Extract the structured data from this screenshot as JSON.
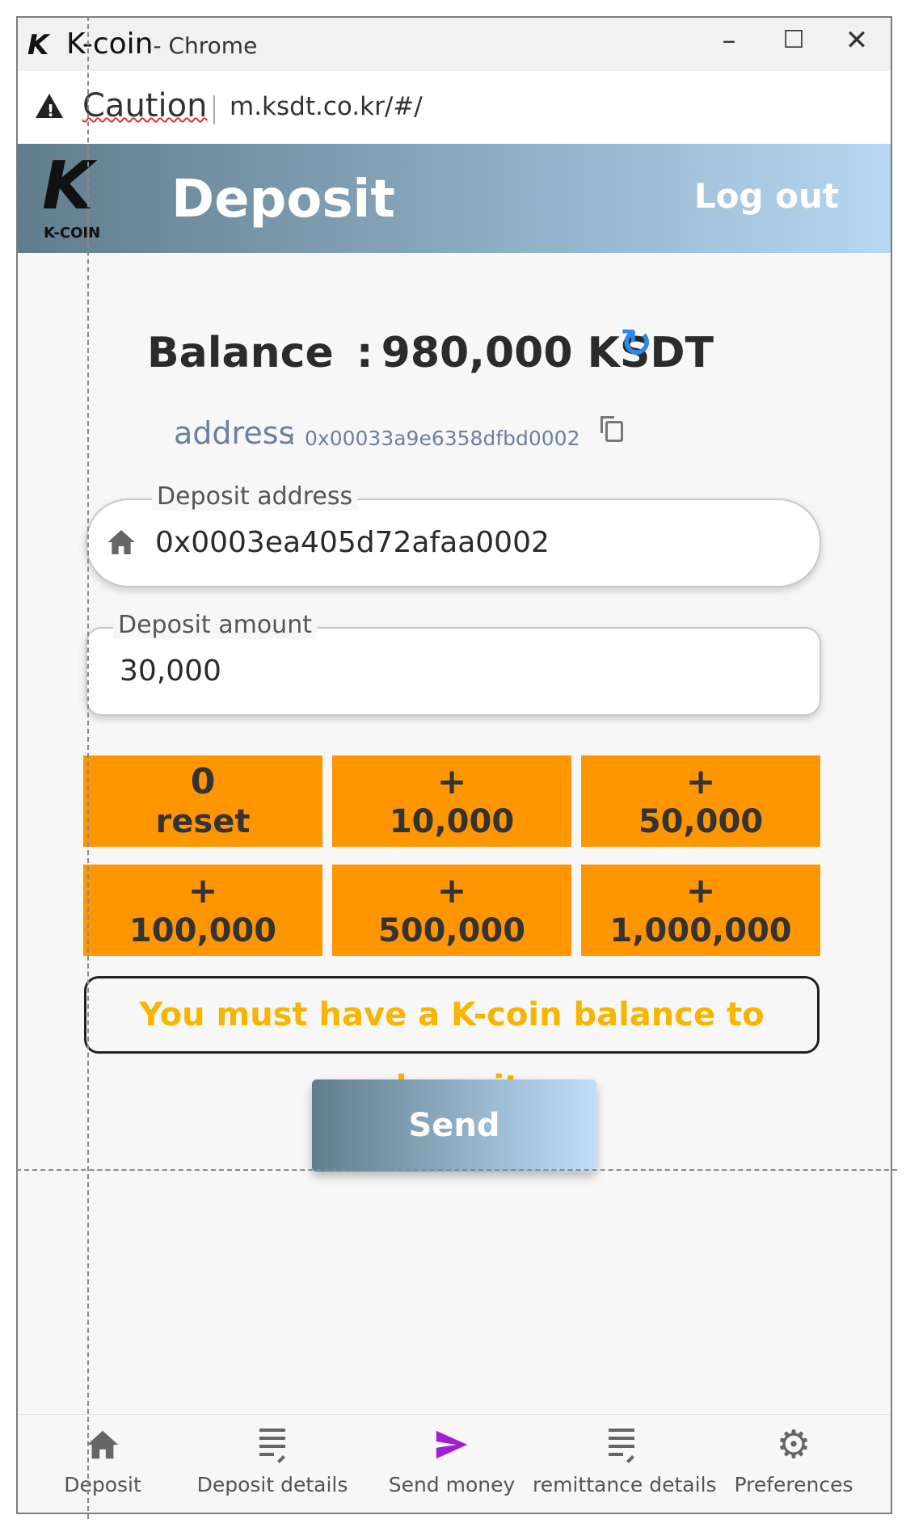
{
  "window": {
    "title": "K-coin",
    "title_suffix": "- Chrome",
    "icon": "k-logo",
    "controls": {
      "minimize": "–",
      "maximize": "☐",
      "close": "✕"
    }
  },
  "addressbar": {
    "security_label": "Caution",
    "url": "m.ksdt.co.kr/#/"
  },
  "header": {
    "logo_letter": "K",
    "logo_text": "K-COIN",
    "title": "Deposit",
    "logout_label": "Log out"
  },
  "balance": {
    "label": "Balance",
    "separator": ":",
    "value": "980,000 KSDT",
    "refresh_icon": "refresh-icon"
  },
  "wallet": {
    "label": "address",
    "separator": ":",
    "value": "0x00033a9e6358dfbd0002",
    "copy_icon": "copy-icon"
  },
  "deposit_address": {
    "label": "Deposit address",
    "value": "0x0003ea405d72afaa0002",
    "icon": "home-icon"
  },
  "deposit_amount": {
    "label": "Deposit amount",
    "value": "30,000"
  },
  "quick_buttons": [
    {
      "top": "0",
      "bottom": "reset"
    },
    {
      "top": "+",
      "bottom": "10,000"
    },
    {
      "top": "+",
      "bottom": "50,000"
    },
    {
      "top": "+",
      "bottom": "100,000"
    },
    {
      "top": "+",
      "bottom": "500,000"
    },
    {
      "top": "+",
      "bottom": "1,000,000"
    }
  ],
  "warning": "You must have a K-coin balance to deposit",
  "send_label": "Send",
  "colors": {
    "accent_orange": "#ff9600",
    "warning_text": "#f7b500",
    "header_gradient_start": "#617d8d",
    "header_gradient_end": "#b7d7f2",
    "active_nav": "#a21ed6"
  },
  "bottom_nav": [
    {
      "label": "Deposit",
      "icon": "home-icon"
    },
    {
      "label": "Deposit details",
      "icon": "list-icon"
    },
    {
      "label": "Send money",
      "icon": "send-icon"
    },
    {
      "label": "remittance details",
      "icon": "list-icon"
    },
    {
      "label": "Preferences",
      "icon": "gear-icon"
    }
  ]
}
